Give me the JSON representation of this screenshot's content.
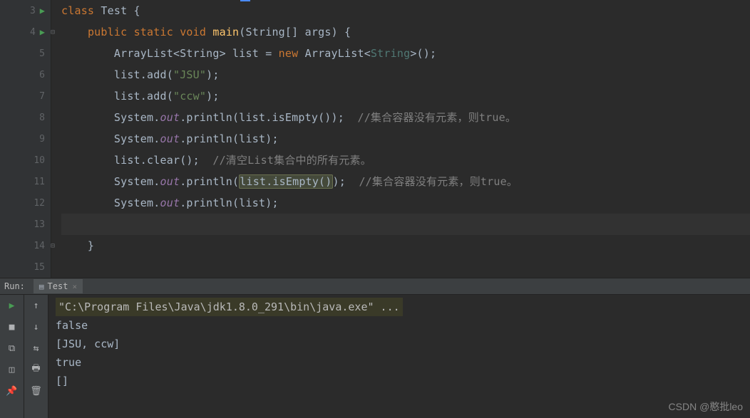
{
  "editor": {
    "lines": [
      {
        "num": "3",
        "runnable": true
      },
      {
        "num": "4",
        "runnable": true
      },
      {
        "num": "5"
      },
      {
        "num": "6"
      },
      {
        "num": "7"
      },
      {
        "num": "8"
      },
      {
        "num": "9"
      },
      {
        "num": "10"
      },
      {
        "num": "11"
      },
      {
        "num": "12"
      },
      {
        "num": "13",
        "current": true
      },
      {
        "num": "14"
      },
      {
        "num": "15"
      }
    ],
    "tokens": {
      "class": "class",
      "Test": "Test",
      "public": "public",
      "static": "static",
      "void": "void",
      "main": "main",
      "String": "String",
      "args": "args",
      "ArrayList": "ArrayList",
      "list": "list",
      "new": "new",
      "add": "add",
      "jsu": "\"JSU\"",
      "ccw": "\"ccw\"",
      "System": "System",
      "out": "out",
      "println": "println",
      "isEmpty": "isEmpty",
      "clear": "clear",
      "comment1": "//集合容器没有元素，则true。",
      "comment2": "//清空List集合中的所有元素。",
      "comment3": "//集合容器没有元素，则true。",
      "highlighted": "list.isEmpty()"
    }
  },
  "panel": {
    "runLabel": "Run:",
    "tabName": "Test",
    "tabClose": "×"
  },
  "console": {
    "cmd": "\"C:\\Program Files\\Java\\jdk1.8.0_291\\bin\\java.exe\" ...",
    "lines": [
      "false",
      "[JSU, ccw]",
      "true",
      "[]"
    ]
  },
  "watermark": "CSDN @憨批leo"
}
